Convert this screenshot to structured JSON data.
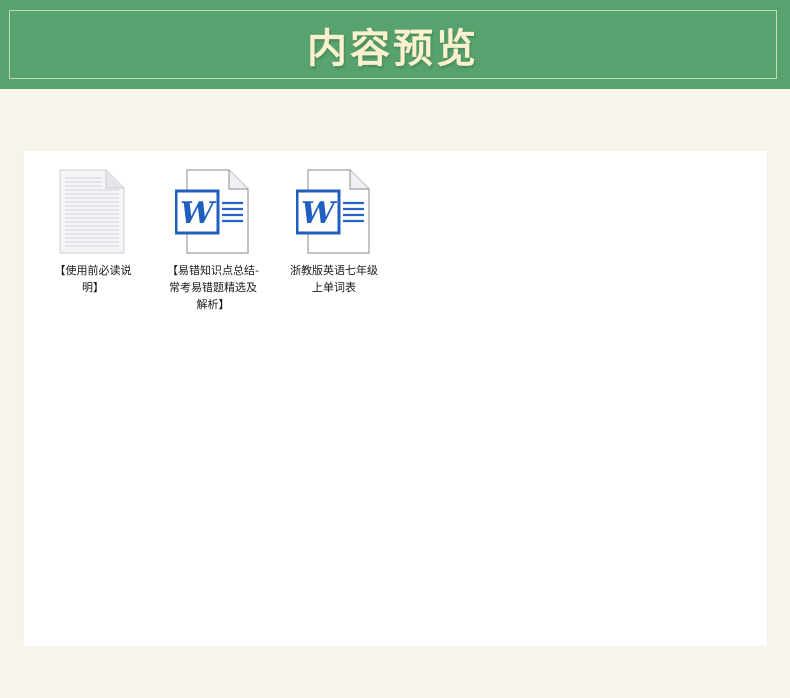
{
  "header": {
    "title": "内容预览"
  },
  "files": [
    {
      "name": "【使用前必读说明】",
      "icon": "text-document-icon"
    },
    {
      "name": "【易错知识点总结-常考易错题精选及解析】",
      "icon": "word-document-icon"
    },
    {
      "name": "浙教版英语七年级上单词表",
      "icon": "word-document-icon"
    }
  ],
  "colors": {
    "header_bg": "#58a26f",
    "title_text": "#fcf1cf",
    "page_bg": "#f7f4ec",
    "word_blue": "#1f5fbf"
  }
}
